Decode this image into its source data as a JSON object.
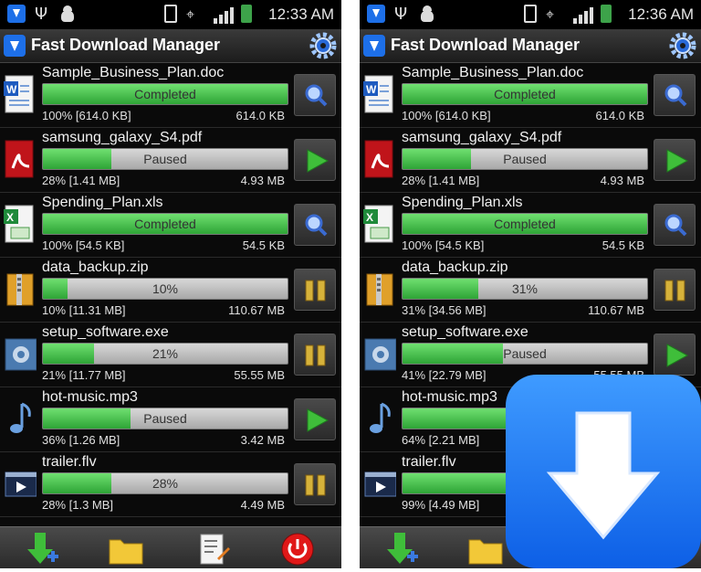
{
  "screens": [
    {
      "status_time": "12:33 AM",
      "app_title": "Fast Download Manager",
      "downloads": [
        {
          "name": "Sample_Business_Plan.doc",
          "icon": "doc-file-icon",
          "progress": 100,
          "bar_label": "Completed",
          "left": "100% [614.0 KB]",
          "right": "614.0 KB",
          "action": "view-icon"
        },
        {
          "name": "samsung_galaxy_S4.pdf",
          "icon": "pdf-file-icon",
          "progress": 28,
          "bar_label": "Paused",
          "left": "28% [1.41 MB]",
          "right": "4.93 MB",
          "action": "play-icon"
        },
        {
          "name": "Spending_Plan.xls",
          "icon": "xls-file-icon",
          "progress": 100,
          "bar_label": "Completed",
          "left": "100% [54.5 KB]",
          "right": "54.5 KB",
          "action": "view-icon"
        },
        {
          "name": "data_backup.zip",
          "icon": "zip-file-icon",
          "progress": 10,
          "bar_label": "10%",
          "left": "10% [11.31 MB]",
          "right": "110.67 MB",
          "action": "pause-icon"
        },
        {
          "name": "setup_software.exe",
          "icon": "exe-file-icon",
          "progress": 21,
          "bar_label": "21%",
          "left": "21% [11.77 MB]",
          "right": "55.55 MB",
          "action": "pause-icon"
        },
        {
          "name": "hot-music.mp3",
          "icon": "music-file-icon",
          "progress": 36,
          "bar_label": "Paused",
          "left": "36% [1.26 MB]",
          "right": "3.42 MB",
          "action": "play-icon"
        },
        {
          "name": "trailer.flv",
          "icon": "video-file-icon",
          "progress": 28,
          "bar_label": "28%",
          "left": "28% [1.3 MB]",
          "right": "4.49 MB",
          "action": "pause-icon"
        }
      ]
    },
    {
      "status_time": "12:36 AM",
      "app_title": "Fast Download Manager",
      "downloads": [
        {
          "name": "Sample_Business_Plan.doc",
          "icon": "doc-file-icon",
          "progress": 100,
          "bar_label": "Completed",
          "left": "100% [614.0 KB]",
          "right": "614.0 KB",
          "action": "view-icon"
        },
        {
          "name": "samsung_galaxy_S4.pdf",
          "icon": "pdf-file-icon",
          "progress": 28,
          "bar_label": "Paused",
          "left": "28% [1.41 MB]",
          "right": "4.93 MB",
          "action": "play-icon"
        },
        {
          "name": "Spending_Plan.xls",
          "icon": "xls-file-icon",
          "progress": 100,
          "bar_label": "Completed",
          "left": "100% [54.5 KB]",
          "right": "54.5 KB",
          "action": "view-icon"
        },
        {
          "name": "data_backup.zip",
          "icon": "zip-file-icon",
          "progress": 31,
          "bar_label": "31%",
          "left": "31% [34.56 MB]",
          "right": "110.67 MB",
          "action": "pause-icon"
        },
        {
          "name": "setup_software.exe",
          "icon": "exe-file-icon",
          "progress": 41,
          "bar_label": "Paused",
          "left": "41% [22.79 MB]",
          "right": "55.55 MB",
          "action": "play-icon"
        },
        {
          "name": "hot-music.mp3",
          "icon": "music-file-icon",
          "progress": 64,
          "bar_label": "",
          "left": "64% [2.21 MB]",
          "right": "",
          "action": ""
        },
        {
          "name": "trailer.flv",
          "icon": "video-file-icon",
          "progress": 99,
          "bar_label": "",
          "left": "99% [4.49 MB]",
          "right": "",
          "action": ""
        }
      ]
    }
  ],
  "bottom_bar": [
    "add-download-icon",
    "folder-icon",
    "settings-list-icon",
    "power-icon"
  ],
  "overlay_logo": "download-app-logo-icon",
  "colors": {
    "progress": "#3fc04a",
    "logo": "#1d6fe8",
    "background": "#0a0a0a"
  }
}
